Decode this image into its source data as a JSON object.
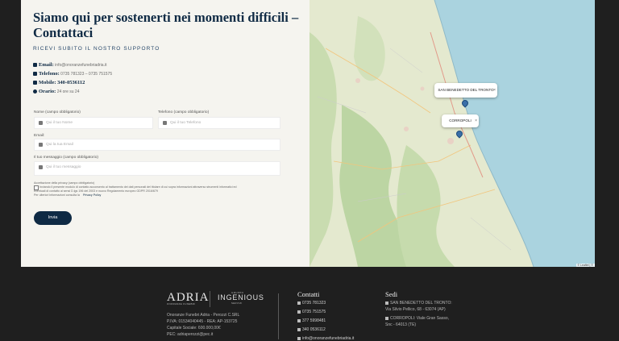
{
  "contact": {
    "title": "Siamo qui per sostenerti nei momenti difficili – Contattaci",
    "subtitle": "RICEVI SUBITO IL NOSTRO SUPPORTO",
    "email_label": "Email:",
    "email_value": "info@onoranzefunebriadria.it",
    "phone_label": "Telefono:",
    "phone_value": "0735 781323 – 0735 751575",
    "mobile_label": "Mobile:",
    "mobile_value": "340-0536112",
    "hours_label": "Orario:",
    "hours_value": "24 ore su 24"
  },
  "form": {
    "name_label": "Nome (campo obbligatorio)",
    "name_placeholder": "Qui il tuo Nome",
    "phone_label": "Telefono (campo obbligatorio)",
    "phone_placeholder": "Qui il tuo Telefono",
    "email_label": "Email:",
    "email_placeholder": "Qui la tua Email",
    "message_label": "Il tuo messaggio (campo obbligatorio)",
    "message_placeholder": "Qui il tuo messaggio",
    "privacy_title": "Accettazione della privacy (campo obbligatorio)",
    "privacy_line1": "Inviando il presente modulo di contatto acconsento al trattamento dei dati personali del titolare di cui sopra informazioni attraverso strumenti informatici ed",
    "privacy_line2": "eventuali di contatto ai sensi D.lgs 196 del 2003 e nuovo Regolamento europeo GDPR 2016/679",
    "privacy_line3": "Per ulteriori informazioni consulta la",
    "privacy_link": "Privacy Policy",
    "submit_label": "Invia"
  },
  "map": {
    "popup1": "SAN BENEDETTO DEL TRONTO",
    "popup2": "CORROPOLI",
    "close_glyph": "×",
    "attribution": "© Leaflet | ©"
  },
  "footer": {
    "logo": "ADRIA",
    "logo_sub": "ONORANZE FUNEBRI",
    "group_label": "GRUPPO",
    "group_name": "INGENIOUS",
    "group_sub": "SERVIZI",
    "company_line1": "Onoranze Funebri Adria - Perozzi C.SRL",
    "company_line2": "P.IVA: 01534040445 - REA: AP-153725",
    "company_line3": "Capitale Sociale: 600.000,00€",
    "company_line4": "PEC: adriaperozzi@pec.it",
    "contacts_heading": "Contatti",
    "contacts": [
      "0735 781323",
      "0735 751575",
      "377 5998481",
      "340 0536112",
      "info@onoranzefunebriadria.it"
    ],
    "sedi_heading": "Sedi",
    "sede1_line1": "SAN BENEDETTO DEL TRONTO:",
    "sede1_line2": "Via Silvio Pellico, 68 - 63074 (AP)",
    "sede2_line1": "CORROPOLI: Viale Gran Sasso,",
    "sede2_line2": "Snc - 64013 (TE)"
  },
  "colors": {
    "brand_navy": "#0f2a44",
    "panel_bg": "#f5f4ef",
    "footer_bg": "#1f1f1f",
    "sea": "#aad3df"
  }
}
